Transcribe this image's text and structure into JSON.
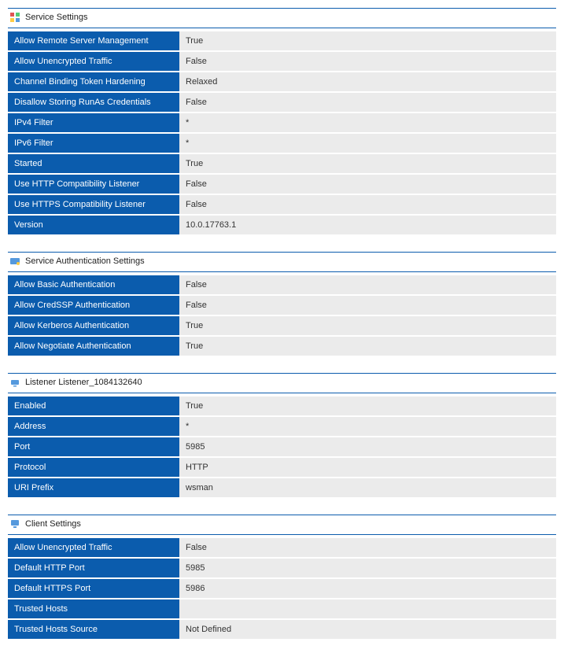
{
  "sections": [
    {
      "id": "service-settings",
      "title": "Service Settings",
      "icon": "service-icon",
      "rows": [
        {
          "label": "Allow Remote Server Management",
          "value": "True"
        },
        {
          "label": "Allow Unencrypted Traffic",
          "value": "False"
        },
        {
          "label": "Channel Binding Token Hardening",
          "value": "Relaxed"
        },
        {
          "label": "Disallow Storing RunAs Credentials",
          "value": "False"
        },
        {
          "label": "IPv4 Filter",
          "value": "*"
        },
        {
          "label": "IPv6 Filter",
          "value": "*"
        },
        {
          "label": "Started",
          "value": "True"
        },
        {
          "label": "Use HTTP Compatibility Listener",
          "value": "False"
        },
        {
          "label": "Use HTTPS Compatibility Listener",
          "value": "False"
        },
        {
          "label": "Version",
          "value": "10.0.17763.1"
        }
      ]
    },
    {
      "id": "service-auth-settings",
      "title": "Service Authentication Settings",
      "icon": "auth-icon",
      "rows": [
        {
          "label": "Allow Basic Authentication",
          "value": "False"
        },
        {
          "label": "Allow CredSSP Authentication",
          "value": "False"
        },
        {
          "label": "Allow Kerberos Authentication",
          "value": "True"
        },
        {
          "label": "Allow Negotiate Authentication",
          "value": "True"
        }
      ]
    },
    {
      "id": "listener",
      "title": "Listener Listener_1084132640",
      "icon": "listener-icon",
      "rows": [
        {
          "label": "Enabled",
          "value": "True"
        },
        {
          "label": "Address",
          "value": "*"
        },
        {
          "label": "Port",
          "value": "5985"
        },
        {
          "label": "Protocol",
          "value": "HTTP"
        },
        {
          "label": "URI Prefix",
          "value": "wsman"
        }
      ]
    },
    {
      "id": "client-settings",
      "title": "Client Settings",
      "icon": "client-icon",
      "rows": [
        {
          "label": "Allow Unencrypted Traffic",
          "value": "False"
        },
        {
          "label": "Default HTTP Port",
          "value": "5985"
        },
        {
          "label": "Default HTTPS Port",
          "value": "5986"
        },
        {
          "label": "Trusted Hosts",
          "value": ""
        },
        {
          "label": "Trusted Hosts Source",
          "value": "Not Defined"
        }
      ]
    }
  ]
}
